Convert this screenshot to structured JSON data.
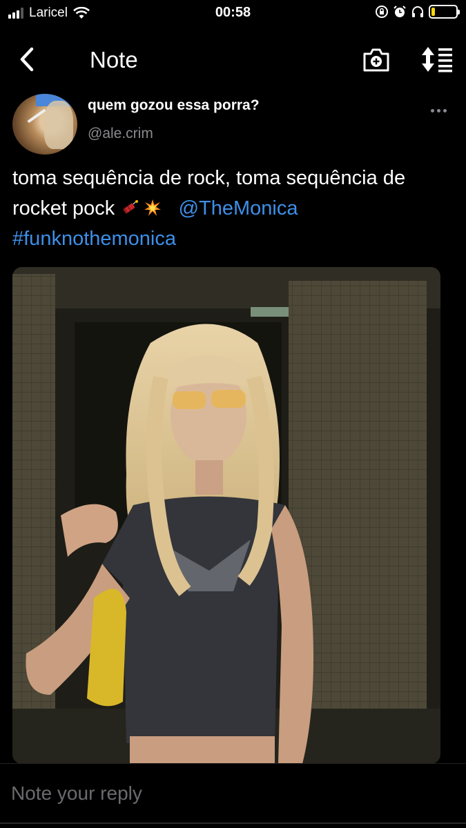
{
  "status_bar": {
    "carrier": "Laricel",
    "time": "00:58",
    "battery_level": 0.15,
    "battery_color": "#ffd60a"
  },
  "nav": {
    "title": "Note",
    "icons": [
      "back-chevron-icon",
      "camera-plus-icon",
      "sort-icon"
    ]
  },
  "post": {
    "display_name": "quem gozou essa porra?",
    "handle": "@ale.crim",
    "text_line1": "toma sequência de rock, toma sequência de rocket pock",
    "emojis": [
      "firecracker-icon",
      "collision-icon"
    ],
    "mention": "@TheMonica",
    "hashtag": "#funknothemonica",
    "link_color": "#3e8fe8"
  },
  "reply": {
    "placeholder": "Note your reply"
  }
}
